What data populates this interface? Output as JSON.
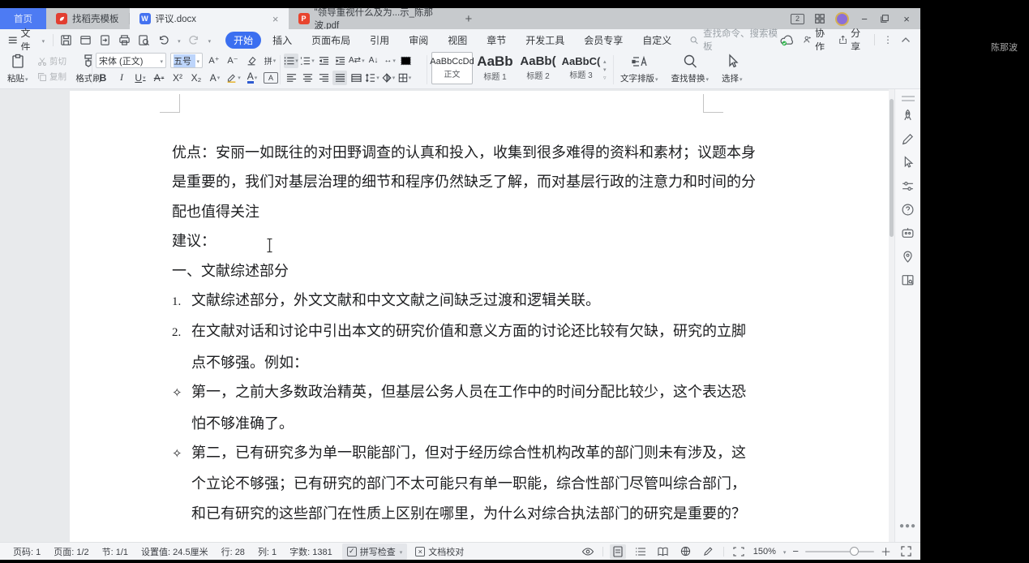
{
  "participant_name": "陈那波",
  "tab_bar": {
    "home_tab": "首页",
    "template_tab": "找稻壳模板",
    "doc_tab": "评议.docx",
    "pdf_tab": "\"领导重视什么及为...示_陈那波.pdf",
    "window_manage_badge": "2"
  },
  "menu_bar": {
    "file": "文件",
    "tabs": [
      {
        "label": "开始",
        "active": true
      },
      {
        "label": "插入"
      },
      {
        "label": "页面布局"
      },
      {
        "label": "引用"
      },
      {
        "label": "审阅"
      },
      {
        "label": "视图"
      },
      {
        "label": "章节"
      },
      {
        "label": "开发工具"
      },
      {
        "label": "会员专享"
      },
      {
        "label": "自定义"
      }
    ],
    "search_placeholder": "查找命令、搜索模板",
    "collab": "协作",
    "share": "分享"
  },
  "ribbon": {
    "paste": "粘贴",
    "cut": "剪切",
    "copy": "复制",
    "format_painter": "格式刷",
    "font_name": "宋体 (正文)",
    "font_size": "五号",
    "phonetic_btn": "拼",
    "bold": "B",
    "italic": "I",
    "underline": "U",
    "strike": "A",
    "superscript": "X²",
    "subscript": "X₂",
    "text_effect": "A",
    "font_color": "A",
    "char_border": "A",
    "styles": [
      {
        "sample": "AaBbCcDd",
        "name": "正文",
        "active": true
      },
      {
        "sample": "AaBb",
        "name": "标题 1"
      },
      {
        "sample": "AaBb(",
        "name": "标题 2"
      },
      {
        "sample": "AaBbC(",
        "name": "标题 3"
      }
    ],
    "text_layout": "文字排版",
    "find_replace": "查找替换",
    "select": "选择"
  },
  "document": {
    "lines": [
      {
        "m": null,
        "t": "优点：安丽一如既往的对田野调查的认真和投入，收集到很多难得的资料和素材；议题本身"
      },
      {
        "m": null,
        "t": "是重要的，我们对基层治理的细节和程序仍然缺乏了解，而对基层行政的注意力和时间的分"
      },
      {
        "m": null,
        "t": "配也值得关注"
      },
      {
        "m": null,
        "t": "",
        "cursor": true
      },
      {
        "m": null,
        "t": "建议："
      },
      {
        "m": null,
        "t": "一、文献综述部分"
      },
      {
        "m": "1.",
        "t": "文献综述部分，外文文献和中文文献之间缺乏过渡和逻辑关联。"
      },
      {
        "m": "2.",
        "t": "在文献对话和讨论中引出本文的研究价值和意义方面的讨论还比较有欠缺，研究的立脚"
      },
      {
        "m": "",
        "t": "点不够强。例如："
      },
      {
        "m": "✧",
        "t": "第一，之前大多数政治精英，但基层公务人员在工作中的时间分配比较少，这个表达恐"
      },
      {
        "m": "",
        "t": "怕不够准确了。"
      },
      {
        "m": "✧",
        "t": "第二，已有研究多为单一职能部门，但对于经历综合性机构改革的部门则未有涉及，这"
      },
      {
        "m": "",
        "t": "个立论不够强；已有研究的部门不太可能只有单一职能，综合性部门尽管叫综合部门，"
      },
      {
        "m": "",
        "t": "和已有研究的这些部门在性质上区别在哪里，为什么对综合执法部门的研究是重要的？"
      }
    ]
  },
  "right_toolbar_icons": [
    "rocket",
    "pen",
    "cursor-select",
    "settings-sliders",
    "help",
    "assistant-card",
    "location-pin",
    "reference-book",
    "more-dots"
  ],
  "status_bar": {
    "items": [
      "页码: 1",
      "页面: 1/2",
      "节: 1/1",
      "设置值: 24.5厘米",
      "行: 28",
      "列: 1",
      "字数: 1381"
    ],
    "spell_check": "拼写检查",
    "doc_proof": "文档校对",
    "zoom_level": "150%"
  },
  "colors": {
    "accent": "#3b6ff0",
    "home_tab": "#4d7bf3",
    "docer_red": "#e23e31",
    "pdf_red": "#e8442e",
    "sync_green": "#2cb24a"
  }
}
